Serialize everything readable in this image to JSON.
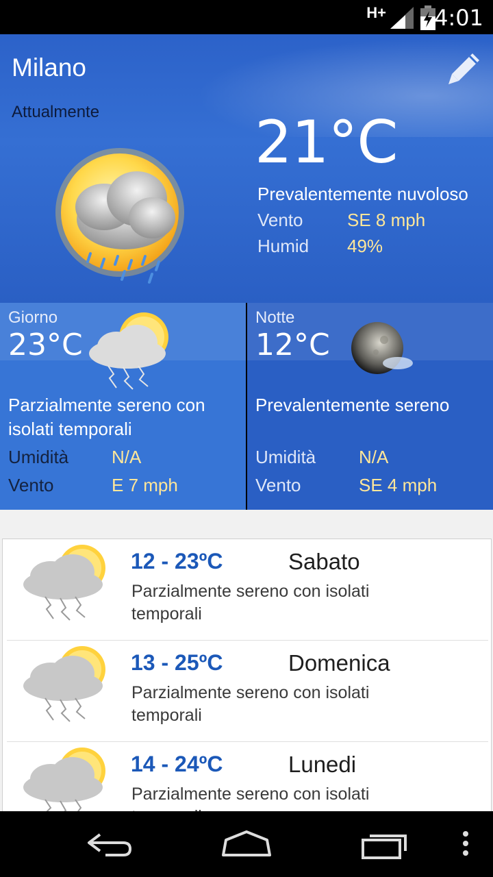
{
  "status_bar": {
    "network": "H+",
    "time": "4:01",
    "icons": [
      "signal-icon",
      "battery-icon"
    ]
  },
  "current": {
    "city": "Milano",
    "label": "Attualmente",
    "temperature": "21°C",
    "condition": "Prevalentemente nuvoloso",
    "wind_label": "Vento",
    "wind_value": "SE 8 mph",
    "humidity_label": "Humid",
    "humidity_value": "49%",
    "icon": "partly-cloudy-rain-icon"
  },
  "day": {
    "label": "Giorno",
    "temperature": "23°C",
    "condition": "Parzialmente sereno con isolati temporali",
    "humidity_label": "Umidità",
    "humidity_value": "N/A",
    "wind_label": "Vento",
    "wind_value": "E 7 mph",
    "icon": "sun-cloud-storm-icon"
  },
  "night": {
    "label": "Notte",
    "temperature": "12°C",
    "condition": "Prevalentemente sereno",
    "humidity_label": "Umidità",
    "humidity_value": "N/A",
    "wind_label": "Vento",
    "wind_value": "SE 4 mph",
    "icon": "moon-cloud-icon"
  },
  "forecast": [
    {
      "range": "12 - 23ºC",
      "day": "Sabato",
      "condition": "Parzialmente sereno con isolati temporali"
    },
    {
      "range": "13 - 25ºC",
      "day": "Domenica",
      "condition": "Parzialmente sereno con isolati temporali"
    },
    {
      "range": "14 - 24ºC",
      "day": "Lunedi",
      "condition": "Parzialmente sereno con isolati temporali"
    }
  ],
  "colors": {
    "hero": "#356fd3",
    "accent_value": "#ffe79a",
    "forecast_range": "#1b58b8"
  },
  "nav_bar": {
    "icons": [
      "back-icon",
      "home-icon",
      "recent-apps-icon",
      "overflow-menu-icon"
    ]
  }
}
